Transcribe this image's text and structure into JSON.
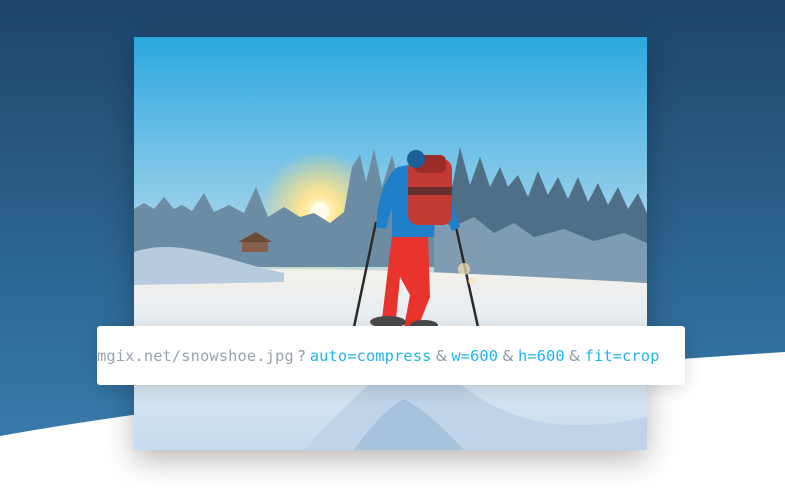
{
  "image": {
    "subject": "snowshoe-hiker-photo",
    "colors": {
      "sky_top": "#2ba7df",
      "sky_horizon": "#f6e7b3",
      "sun": "#fff6c8",
      "jacket": "#1f7fc8",
      "pants": "#e8342c",
      "backpack": "#c23a34",
      "snow": "#eaf2fa",
      "snow_shadow": "#b9cfe3",
      "trees": "#5b7b93"
    }
  },
  "url": {
    "base": "mgix.net/snowshoe.jpg",
    "query_separator": "?",
    "param_separator": "&",
    "params": [
      "auto=compress",
      "w=600",
      "h=600",
      "fit=crop"
    ]
  },
  "colors": {
    "background_top": "#1e456b",
    "background_bottom": "#3a80b2",
    "param_text": "#21b4ea",
    "base_text": "#98a2ad"
  }
}
